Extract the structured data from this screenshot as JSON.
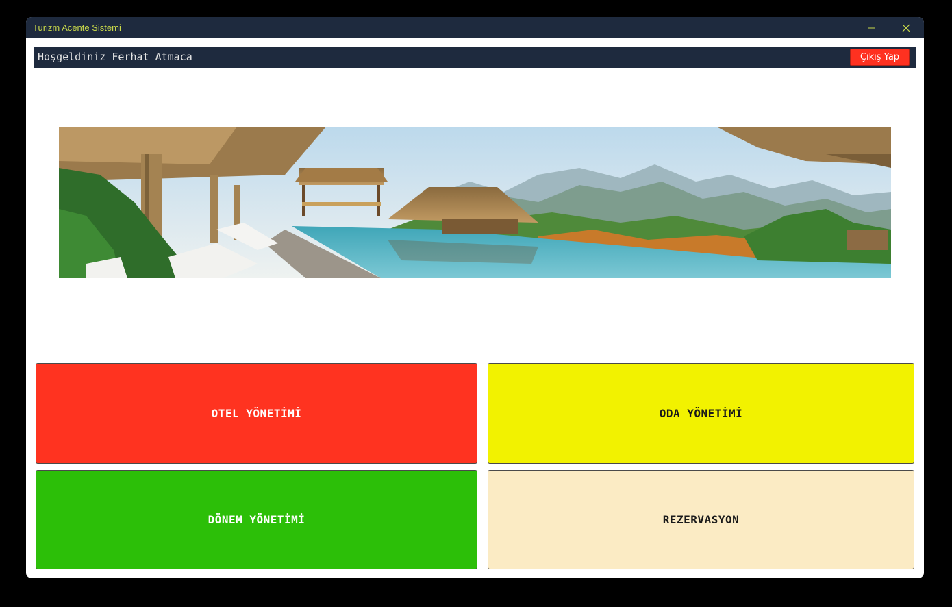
{
  "window": {
    "title": "Turizm Acente Sistemi",
    "title_color": "#c9d94a",
    "titlebar_color": "#1e2a3e",
    "controls": [
      "minimize-icon",
      "close-icon"
    ]
  },
  "header": {
    "welcome_text": "Hoşgeldiniz Ferhat Atmaca",
    "logout_label": "Çıkış Yap",
    "logout_color": "#ff3120"
  },
  "banner": {
    "description_icon": "resort-pool-banner-image"
  },
  "menu": {
    "hotel_management": {
      "label": "OTEL YÖNETİMİ",
      "color": "#ff3320"
    },
    "room_management": {
      "label": "ODA YÖNETİMİ",
      "color": "#f2f200"
    },
    "season_management": {
      "label": "DÖNEM YÖNETİMİ",
      "color": "#2cbf08"
    },
    "reservation": {
      "label": "REZERVASYON",
      "color": "#fbebc4"
    }
  }
}
